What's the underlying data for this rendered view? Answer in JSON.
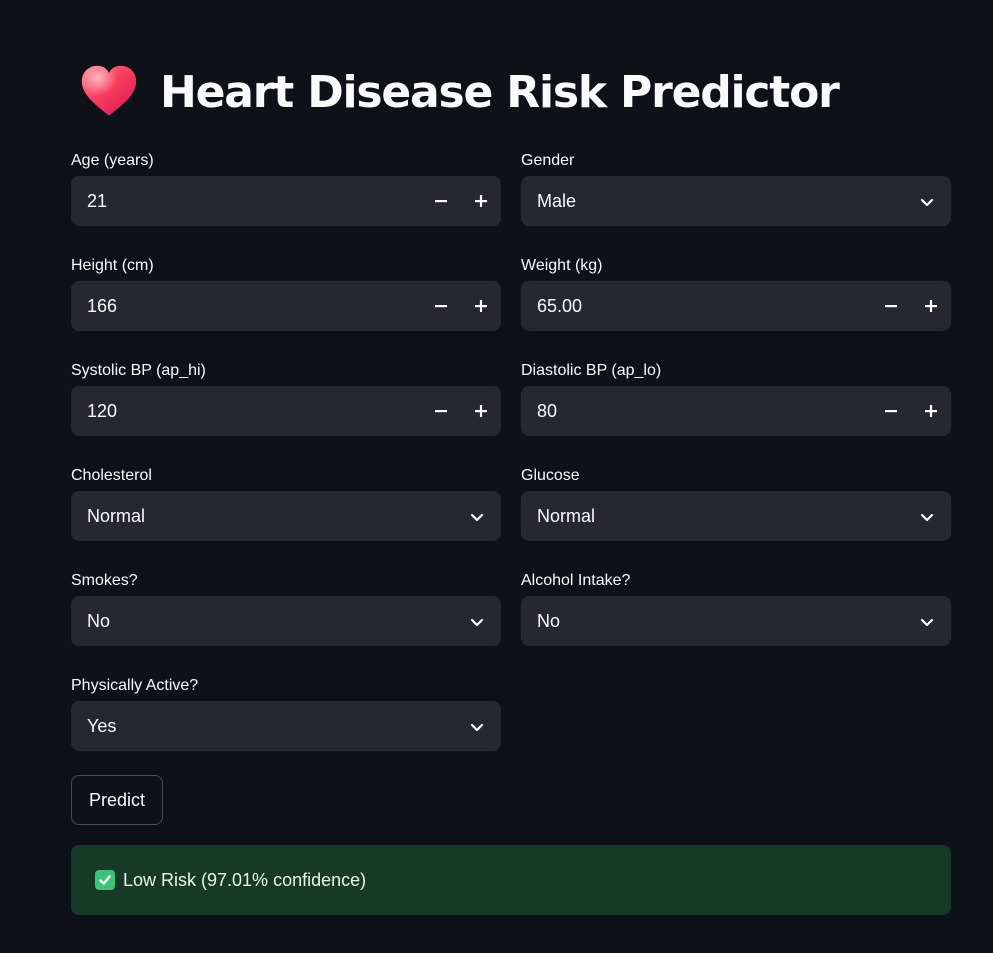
{
  "header": {
    "title": "Heart Disease Risk Predictor",
    "icon": "heart-icon"
  },
  "form": {
    "age": {
      "label": "Age (years)",
      "value": "21"
    },
    "gender": {
      "label": "Gender",
      "value": "Male"
    },
    "height": {
      "label": "Height (cm)",
      "value": "166"
    },
    "weight": {
      "label": "Weight (kg)",
      "value": "65.00"
    },
    "systolic": {
      "label": "Systolic BP (ap_hi)",
      "value": "120"
    },
    "diastolic": {
      "label": "Diastolic BP (ap_lo)",
      "value": "80"
    },
    "cholesterol": {
      "label": "Cholesterol",
      "value": "Normal"
    },
    "glucose": {
      "label": "Glucose",
      "value": "Normal"
    },
    "smokes": {
      "label": "Smokes?",
      "value": "No"
    },
    "alcohol": {
      "label": "Alcohol Intake?",
      "value": "No"
    },
    "active": {
      "label": "Physically Active?",
      "value": "Yes"
    }
  },
  "actions": {
    "predict_label": "Predict"
  },
  "result": {
    "message": "Low Risk (97.01% confidence)",
    "status": "success",
    "icon": "check-icon"
  },
  "colors": {
    "background": "#0e1117",
    "input_bg": "#262730",
    "success_bg": "#173928",
    "check": "#3ec27a"
  }
}
